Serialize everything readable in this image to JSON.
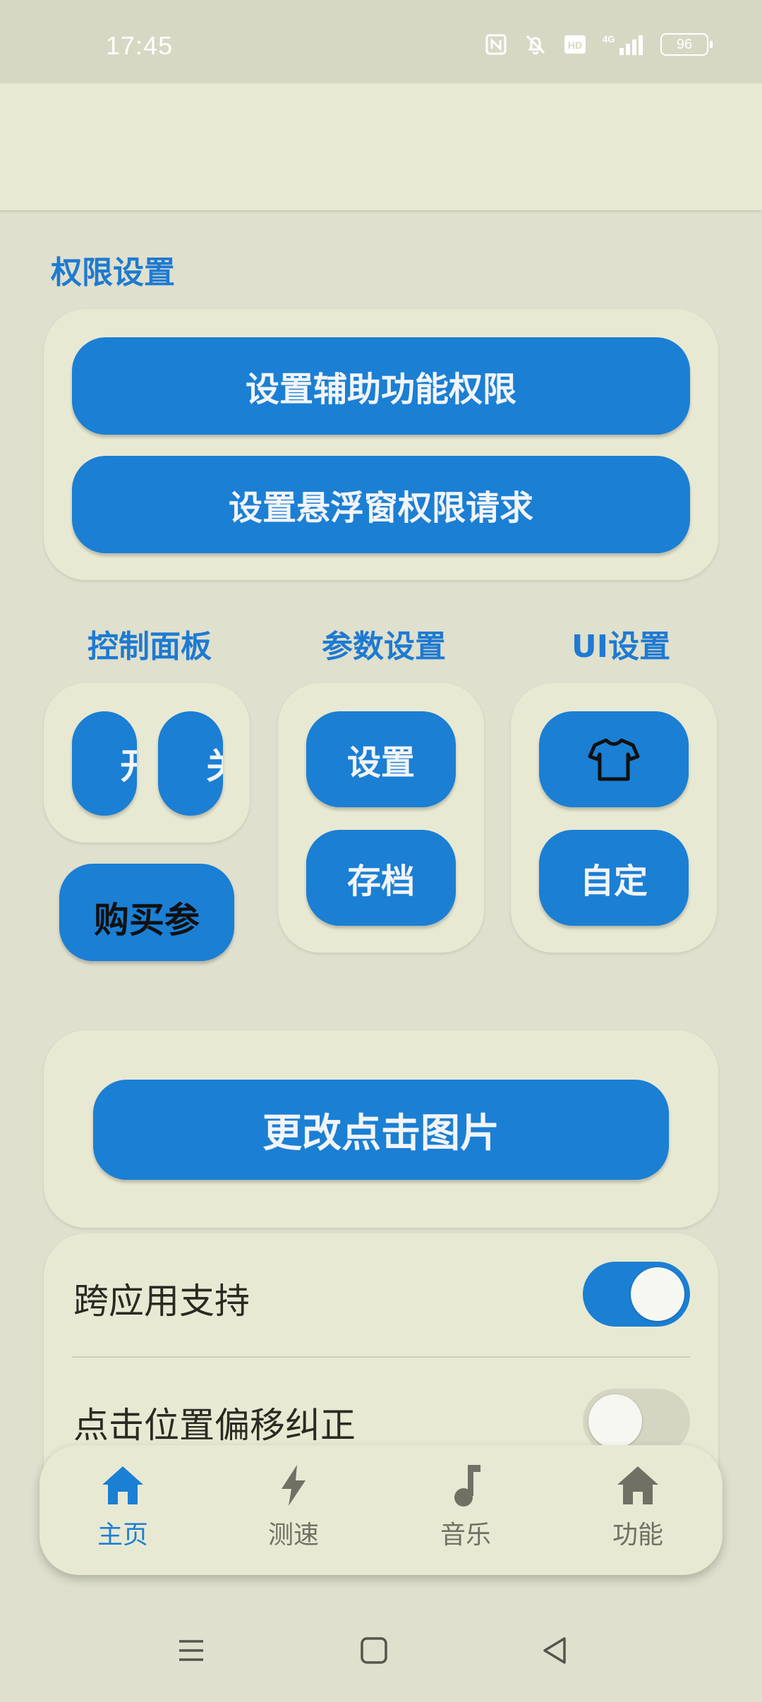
{
  "status_bar": {
    "time": "17:45",
    "battery": "96"
  },
  "permissions": {
    "title": "权限设置",
    "accessibility_button": "设置辅助功能权限",
    "overlay_button": "设置悬浮窗权限请求"
  },
  "control_panel": {
    "title": "控制面板",
    "btn_left": "开",
    "btn_right": "关",
    "buy_button": "购买参"
  },
  "params": {
    "title": "参数设置",
    "settings_button": "设置",
    "save_button": "存档"
  },
  "ui_settings": {
    "title": "UI设置",
    "shirt_icon": "shirt-icon",
    "custom_button": "自定"
  },
  "change_image_button": "更改点击图片",
  "toggles": [
    {
      "label": "跨应用支持",
      "on": true
    },
    {
      "label": "点击位置偏移纠正",
      "on": false
    }
  ],
  "nav": [
    {
      "label": "主页",
      "icon": "home-icon",
      "active": true
    },
    {
      "label": "测速",
      "icon": "bolt-icon",
      "active": false
    },
    {
      "label": "音乐",
      "icon": "music-note-icon",
      "active": false
    },
    {
      "label": "功能",
      "icon": "home-icon",
      "active": false
    }
  ],
  "colors": {
    "accent": "#1b7fd4",
    "inactive": "#707064",
    "background": "#dfe0cd"
  }
}
